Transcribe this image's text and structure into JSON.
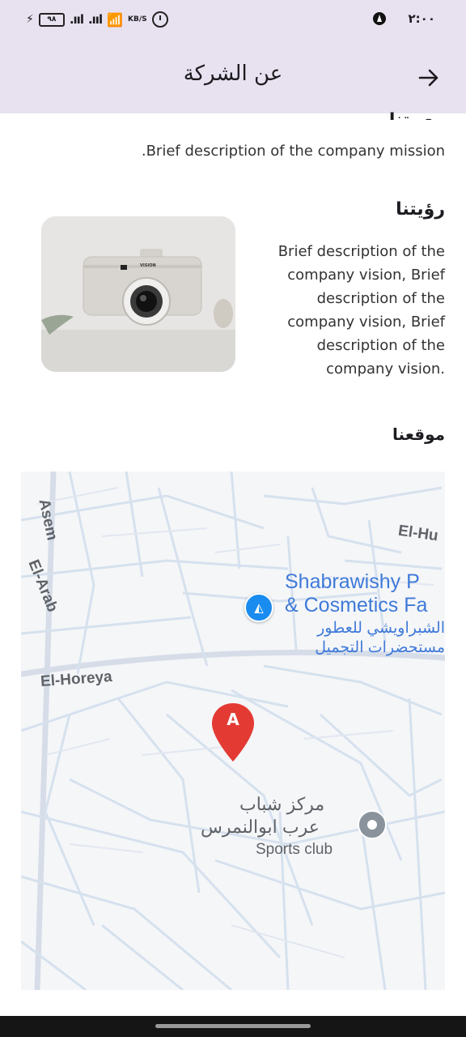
{
  "status_bar": {
    "battery": "٩٨",
    "speed_unit": "KB/S",
    "time": "٢:٠٠"
  },
  "app_bar": {
    "title": "عن الشركة",
    "back_icon": "arrow-right-icon"
  },
  "mission": {
    "heading": "مهمتنا",
    "text": ".Brief description of the company mission"
  },
  "vision": {
    "heading": "رؤيتنا",
    "text": "Brief description of the company vision, Brief description of the company vision, Brief description of the company vision.",
    "image_label": "VISION"
  },
  "location": {
    "heading": "موقعنا",
    "map": {
      "streets": [
        "Asem",
        "El-Arab",
        "El-Hu",
        "El-Horeya"
      ],
      "place_1_en": "Shabrawishy P",
      "place_1_en_2": "& Cosmetics Fa",
      "place_1_ar": "الشبراويشي للعطور",
      "place_1_ar_2": "مستحضرات التجميل",
      "marker_label": "A",
      "place_2_ar": "مركز شباب",
      "place_2_ar_2": "عرب ابوالنمرس",
      "place_2_en": "Sports club"
    }
  }
}
